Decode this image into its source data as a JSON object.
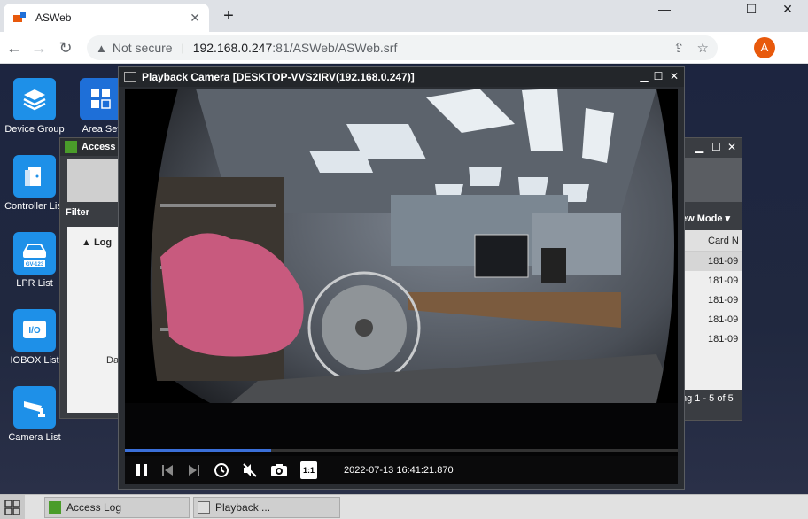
{
  "browser": {
    "tab_title": "ASWeb",
    "tab_close": "✕",
    "new_tab": "+",
    "win_min": "—",
    "win_max": "☐",
    "win_close": "✕",
    "back": "←",
    "forward": "→",
    "reload": "↻",
    "security_label": "Not secure",
    "url_host": "192.168.0.247",
    "url_rest": ":81/ASWeb/ASWeb.srf",
    "share": "⇪",
    "star": "☆",
    "sidepanel": "◧",
    "avatar_letter": "A",
    "menu": "⋮"
  },
  "desktop_icons": [
    {
      "label": "Device Group",
      "icon": "layers-icon"
    },
    {
      "label": "Area Set",
      "icon": "area-grid-icon"
    },
    {
      "label": "Controller List",
      "icon": "controller-door-icon"
    },
    {
      "label": "LPR List",
      "icon": "car-plate-icon",
      "plate": "GV-123"
    },
    {
      "label": "IOBOX List",
      "icon": "iobox-icon",
      "text": "I/O"
    },
    {
      "label": "Camera List",
      "icon": "camera-icon"
    }
  ],
  "access_window": {
    "title": "Access",
    "filter_label": "Filter",
    "log_label": "▲ Log",
    "fragment": "Da"
  },
  "log_window": {
    "min": "▁",
    "max": "☐",
    "close": "✕",
    "view_mode": "ew Mode ▾",
    "column_header": "Card N",
    "rows": [
      "181-09",
      "181-09",
      "181-09",
      "181-09",
      "181-09"
    ],
    "paging": "ng 1 - 5 of 5"
  },
  "playback": {
    "title": "Playback Camera [DESKTOP-VVS2IRV(192.168.0.247)]",
    "min": "▁",
    "max": "☐",
    "close": "✕",
    "progress": 0.265,
    "timestamp": "2022-07-13 16:41:21.870",
    "ratio_label": "1:1",
    "controls": [
      "pause-icon",
      "prev-frame-icon",
      "next-frame-icon",
      "clock-icon",
      "mute-icon",
      "snapshot-icon",
      "ratio-icon"
    ]
  },
  "taskbar": {
    "items": [
      {
        "label": "Access Log",
        "icon": "access-log-icon"
      },
      {
        "label": "Playback ...",
        "icon": "playback-icon"
      }
    ]
  },
  "colors": {
    "accent": "#1e90e8",
    "progress": "#3a6fd8",
    "avatar": "#e8590c"
  }
}
